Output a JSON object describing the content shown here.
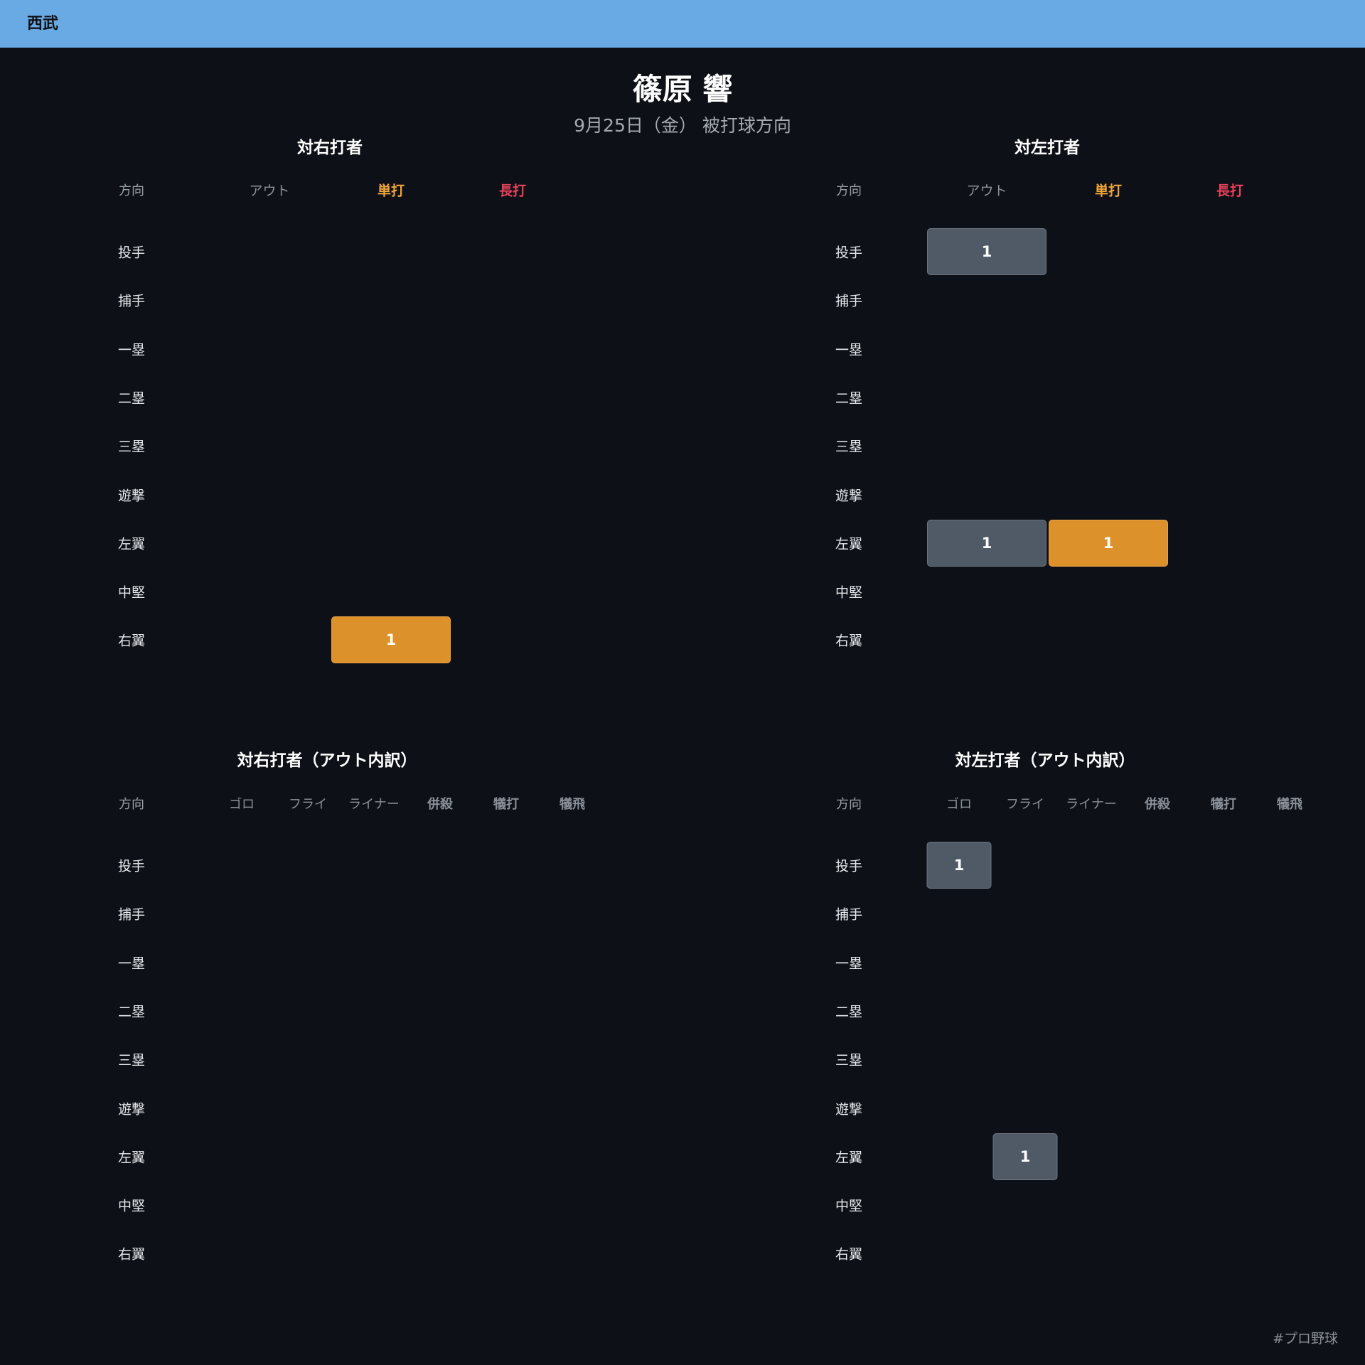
{
  "header": {
    "team": "西武"
  },
  "player_name": "篠原 響",
  "subtitle": "9月25日（金） 被打球方向",
  "footer": "#プロ野球",
  "colors": {
    "out": "#4f5a66",
    "single": "#f0a63a",
    "long": "#e8415a",
    "muted": "#8a9099",
    "header_bar": "#6aaae4"
  },
  "chart_data": [
    {
      "type": "table",
      "title": "対右打者",
      "row_header": "方向",
      "rows": [
        "投手",
        "捕手",
        "一塁",
        "二塁",
        "三塁",
        "遊撃",
        "左翼",
        "中堅",
        "右翼"
      ],
      "columns": [
        "アウト",
        "単打",
        "長打"
      ],
      "cells": [
        {
          "row": "右翼",
          "column": "単打",
          "value": 1
        }
      ]
    },
    {
      "type": "table",
      "title": "対左打者",
      "row_header": "方向",
      "rows": [
        "投手",
        "捕手",
        "一塁",
        "二塁",
        "三塁",
        "遊撃",
        "左翼",
        "中堅",
        "右翼"
      ],
      "columns": [
        "アウト",
        "単打",
        "長打"
      ],
      "cells": [
        {
          "row": "投手",
          "column": "アウト",
          "value": 1
        },
        {
          "row": "左翼",
          "column": "アウト",
          "value": 1
        },
        {
          "row": "左翼",
          "column": "単打",
          "value": 1
        }
      ]
    },
    {
      "type": "table",
      "title": "対右打者（アウト内訳）",
      "row_header": "方向",
      "rows": [
        "投手",
        "捕手",
        "一塁",
        "二塁",
        "三塁",
        "遊撃",
        "左翼",
        "中堅",
        "右翼"
      ],
      "columns": [
        "ゴロ",
        "フライ",
        "ライナー",
        "併殺",
        "犠打",
        "犠飛"
      ],
      "cells": []
    },
    {
      "type": "table",
      "title": "対左打者（アウト内訳）",
      "row_header": "方向",
      "rows": [
        "投手",
        "捕手",
        "一塁",
        "二塁",
        "三塁",
        "遊撃",
        "左翼",
        "中堅",
        "右翼"
      ],
      "columns": [
        "ゴロ",
        "フライ",
        "ライナー",
        "併殺",
        "犠打",
        "犠飛"
      ],
      "cells": [
        {
          "row": "投手",
          "column": "ゴロ",
          "value": 1
        },
        {
          "row": "左翼",
          "column": "フライ",
          "value": 1
        }
      ]
    }
  ]
}
